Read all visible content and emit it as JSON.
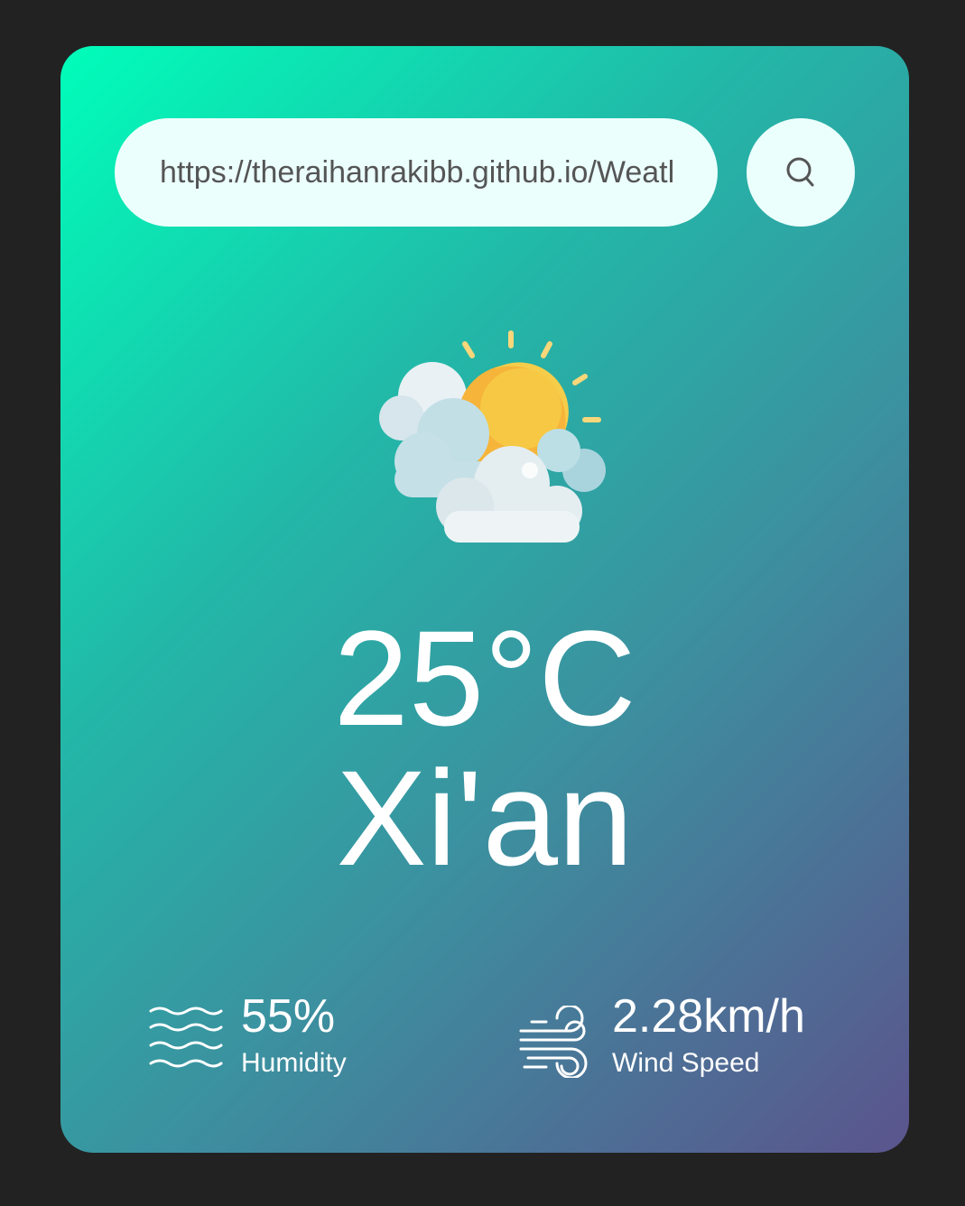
{
  "search": {
    "value": "https://theraihanrakibb.github.io/Weather-App/",
    "icon": "search-icon"
  },
  "weather": {
    "icon": "partly-cloudy-icon",
    "temperature": "25°C",
    "city": "Xi'an"
  },
  "details": {
    "humidity": {
      "icon": "humidity-waves-icon",
      "value": "55%",
      "label": "Humidity"
    },
    "wind": {
      "icon": "wind-icon",
      "value": "2.28km/h",
      "label": "Wind Speed"
    }
  },
  "colors": {
    "background": "#222222",
    "gradient_start": "#00feba",
    "gradient_end": "#5b548d",
    "input_bg": "#ebfffc",
    "text": "#ffffff"
  }
}
